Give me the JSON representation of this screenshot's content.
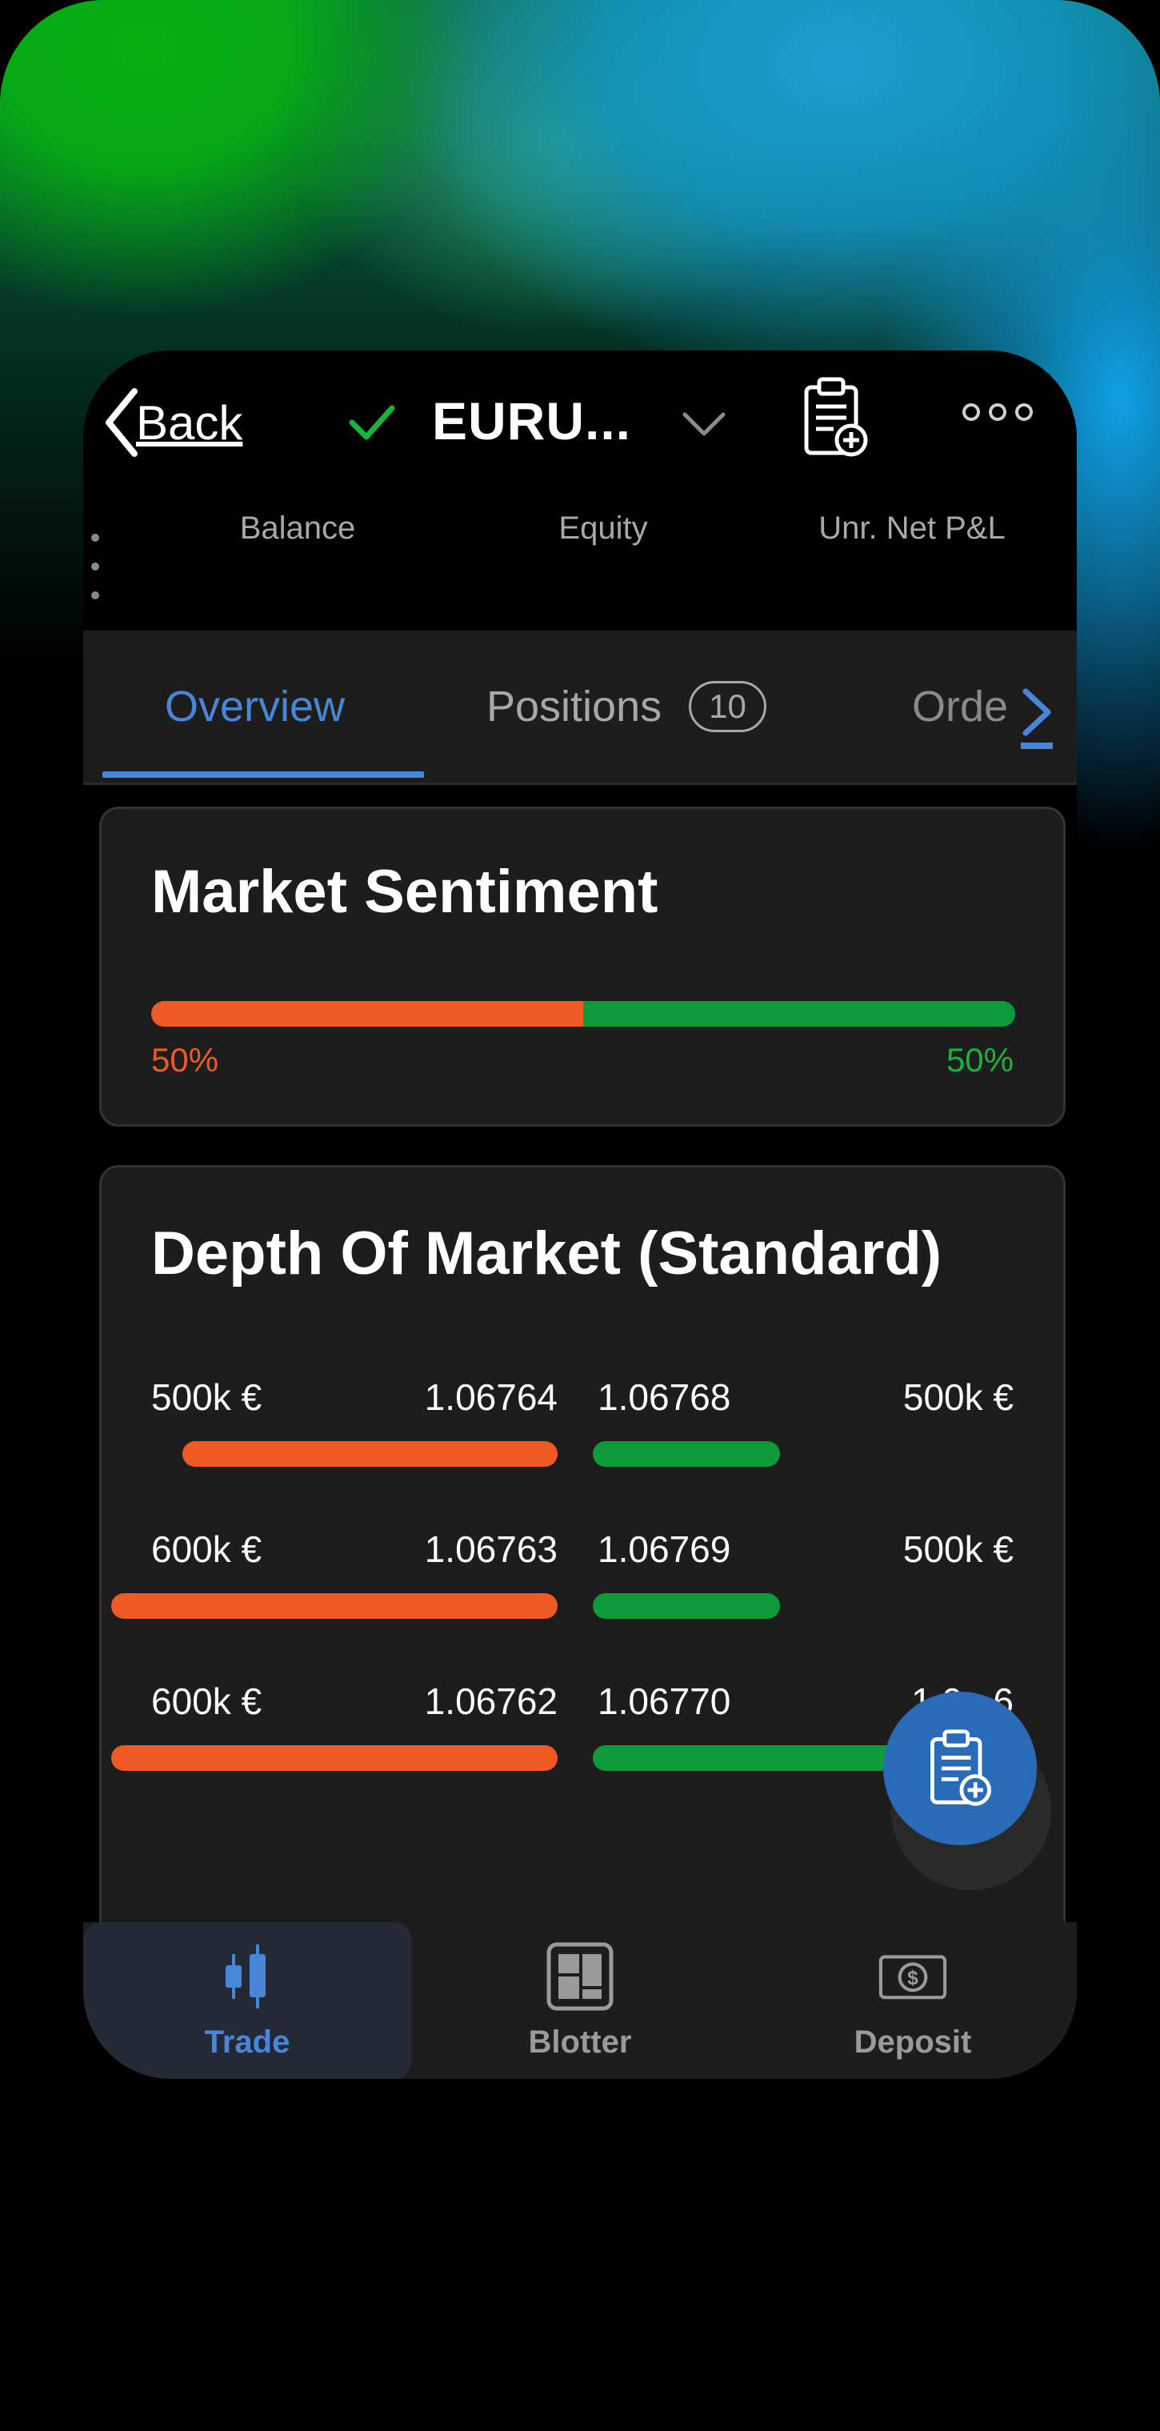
{
  "header": {
    "back_label": "Back",
    "symbol": "EURU...",
    "account": {
      "balance_label": "Balance",
      "equity_label": "Equity",
      "pnl_label": "Unr. Net P&L"
    }
  },
  "tabs": [
    {
      "label": "Overview",
      "active": true
    },
    {
      "label": "Positions",
      "badge": "10"
    },
    {
      "label": "Orde"
    }
  ],
  "sentiment": {
    "title": "Market Sentiment",
    "sell_pct": 50,
    "buy_pct": 50,
    "sell_label": "50%",
    "buy_label": "50%",
    "sell_color": "#ef5a24",
    "buy_color": "#0f9a3a"
  },
  "depth": {
    "title": "Depth Of Market (Standard)",
    "rows": [
      {
        "bid_volume": "500k €",
        "bid_price": "1.06764",
        "ask_price": "1.06768",
        "ask_volume": "500k €",
        "bid_fill": 0.84,
        "ask_fill": 0.45
      },
      {
        "bid_volume": "600k €",
        "bid_price": "1.06763",
        "ask_price": "1.06769",
        "ask_volume": "500k €",
        "bid_fill": 1.0,
        "ask_fill": 0.45
      },
      {
        "bid_volume": "600k €",
        "bid_price": "1.06762",
        "ask_price": "1.06770",
        "ask_volume": "1.0...6",
        "bid_fill": 1.0,
        "ask_fill": 0.9
      }
    ]
  },
  "bottom_nav": [
    {
      "label": "Trade",
      "icon": "candlestick-icon",
      "active": true
    },
    {
      "label": "Blotter",
      "icon": "blotter-icon"
    },
    {
      "label": "Deposit",
      "icon": "dollar-bill-icon"
    }
  ],
  "colors": {
    "accent": "#4a86d8",
    "sell": "#ef5a24",
    "buy": "#0f9a3a",
    "fab": "#2a6bb8"
  }
}
